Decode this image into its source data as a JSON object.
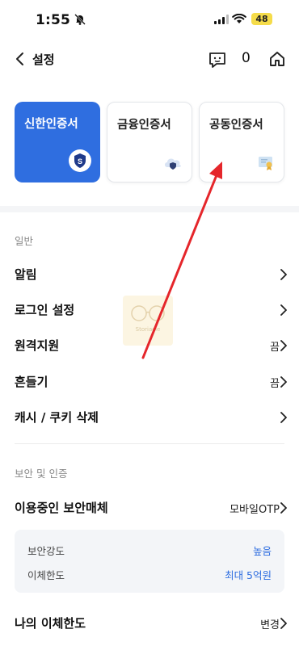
{
  "status_bar": {
    "time": "1:55",
    "battery": "48"
  },
  "nav": {
    "title": "설정",
    "count": "0"
  },
  "cards": [
    {
      "label": "신한인증서",
      "active": true
    },
    {
      "label": "금융인증서",
      "active": false
    },
    {
      "label": "공동인증서",
      "active": false
    }
  ],
  "general": {
    "section_label": "일반",
    "rows": [
      {
        "label": "알림",
        "value": ""
      },
      {
        "label": "로그인 설정",
        "value": ""
      },
      {
        "label": "원격지원",
        "value": "끔"
      },
      {
        "label": "흔들기",
        "value": "끔"
      },
      {
        "label": "캐시 / 쿠키 삭제",
        "value": ""
      }
    ]
  },
  "security": {
    "section_label": "보안 및 인증",
    "media_label": "이용중인 보안매체",
    "media_value": "모바일OTP",
    "strength_label": "보안강도",
    "strength_value": "높음",
    "limit_label": "이체한도",
    "limit_value": "최대 5억원",
    "partial_label": "나의 이체한도",
    "partial_value": "변경"
  },
  "watermark": {
    "text": "Storiacle"
  },
  "colors": {
    "accent": "#2f6ee0",
    "arrow": "#e5262b"
  }
}
